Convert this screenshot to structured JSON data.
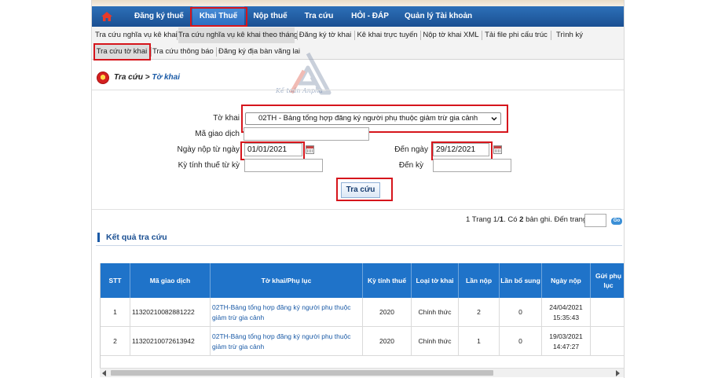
{
  "main_nav": {
    "items": [
      "Đăng ký thuế",
      "Khai Thuế",
      "Nộp thuế",
      "Tra cứu",
      "HỎI - ĐÁP",
      "Quản lý Tài khoản"
    ]
  },
  "sub_nav": {
    "row1": [
      "Tra cứu nghĩa vụ kê khai",
      "Tra cứu nghĩa vụ kê khai theo tháng",
      "Đăng ký tờ khai",
      "Kê khai trực tuyến",
      "Nộp tờ khai XML",
      "Tải file phi cấu trúc",
      "Trình ký"
    ],
    "row2": [
      "Tra cứu tờ khai",
      "Tra cứu thông báo",
      "Đăng ký địa bàn vãng lai"
    ]
  },
  "breadcrumb": {
    "root": "Tra cứu",
    "sep": ">",
    "current": "Tờ khai"
  },
  "watermark": {
    "text": "Kế toán Anpha"
  },
  "form": {
    "to_khai_label": "Tờ khai",
    "to_khai_value": "02TH - Bảng tổng hợp đăng ký người phụ thuộc giảm trừ gia cảnh",
    "ma_giao_dich_label": "Mã giao dịch",
    "ma_giao_dich_value": "",
    "ngay_nop_tu_label": "Ngày nộp từ ngày",
    "ngay_nop_tu_value": "01/01/2021",
    "den_ngay_label": "Đến ngày",
    "den_ngay_value": "29/12/2021",
    "ky_tinh_thue_label": "Kỳ tính thuế từ kỳ",
    "ky_tinh_thue_value": "",
    "den_ky_label": "Đến kỳ",
    "den_ky_value": "",
    "search_button": "Tra cứu"
  },
  "pager": {
    "text_prefix": "1  Trang 1/",
    "total_pages": "1",
    "text_mid": ". Có ",
    "total_records": "2",
    "text_suffix": " bản ghi. Đến trang",
    "go_label": "Go",
    "page_input": ""
  },
  "results": {
    "title": "Kết quả tra cứu",
    "columns": [
      "STT",
      "Mã giao dịch",
      "Tờ khai/Phụ lục",
      "Kỳ tính thuế",
      "Loại tờ khai",
      "Lần nộp",
      "Lần bổ sung",
      "Ngày nộp",
      "Gửi phụ lục"
    ],
    "rows": [
      {
        "stt": "1",
        "ma": "11320210082881222",
        "to_khai": "02TH-Bảng tổng hợp đăng ký người phụ thuộc giảm trừ gia cảnh",
        "ky": "2020",
        "loai": "Chính thức",
        "lan_nop": "2",
        "lan_bs": "0",
        "ngay": "24/04/2021 15:35:43"
      },
      {
        "stt": "2",
        "ma": "11320210072613942",
        "to_khai": "02TH-Bảng tổng hợp đăng ký người phụ thuộc giảm trừ gia cảnh",
        "ky": "2020",
        "loai": "Chính thức",
        "lan_nop": "1",
        "lan_bs": "0",
        "ngay": "19/03/2021 14:47:27"
      }
    ]
  },
  "colors": {
    "nav_blue": "#1a4f92",
    "highlight_red": "#d6151c",
    "table_header": "#1f73c9",
    "link_blue": "#1a5aa6"
  }
}
